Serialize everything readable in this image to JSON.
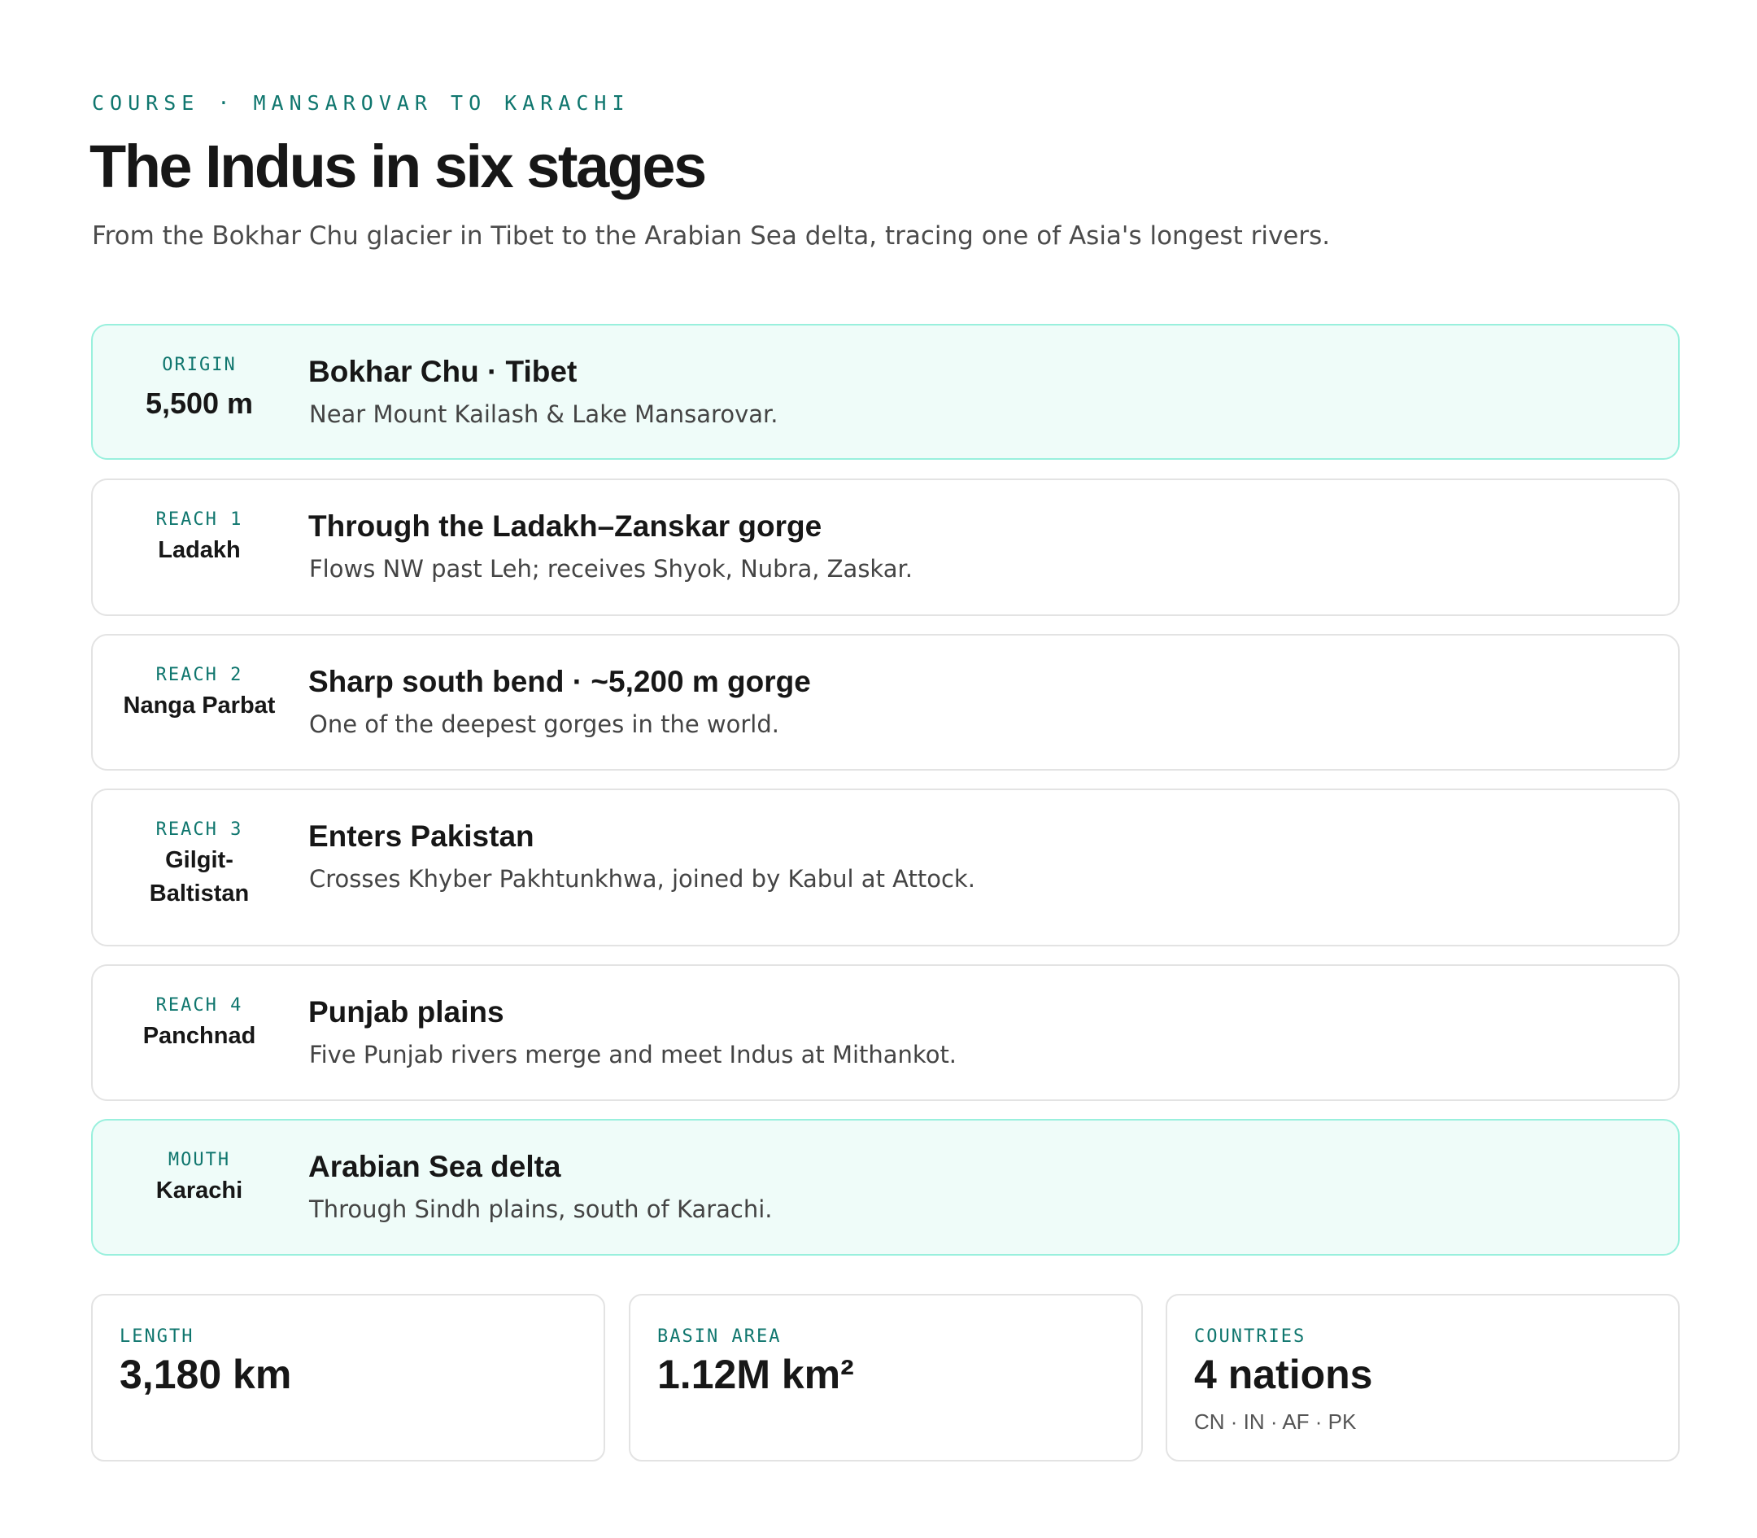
{
  "header": {
    "eyebrow": "COURSE · MANSAROVAR TO KARACHI",
    "title": "The Indus in six stages",
    "subtitle": "From the Bokhar Chu glacier in Tibet to the Arabian Sea delta, tracing one of Asia's longest rivers."
  },
  "stages": [
    {
      "tag": "ORIGIN",
      "place": "5,500 m",
      "heading": "Bokhar Chu · Tibet",
      "description": "Near Mount Kailash & Lake Mansarovar.",
      "highlighted": true
    },
    {
      "tag": "REACH 1",
      "place": "Ladakh",
      "heading": "Through the Ladakh–Zanskar gorge",
      "description": "Flows NW past Leh; receives Shyok, Nubra, Zaskar.",
      "highlighted": false
    },
    {
      "tag": "REACH 2",
      "place": "Nanga Parbat",
      "heading": "Sharp south bend · ~5,200 m gorge",
      "description": "One of the deepest gorges in the world.",
      "highlighted": false
    },
    {
      "tag": "REACH 3",
      "place_line_1": "Gilgit-",
      "place_line_2": "Baltistan",
      "heading": "Enters Pakistan",
      "description": "Crosses Khyber Pakhtunkhwa, joined by Kabul at Attock.",
      "highlighted": false
    },
    {
      "tag": "REACH 4",
      "place": "Panchnad",
      "heading": "Punjab plains",
      "description": "Five Punjab rivers merge and meet Indus at Mithankot.",
      "highlighted": false
    },
    {
      "tag": "MOUTH",
      "place": "Karachi",
      "heading": "Arabian Sea delta",
      "description": "Through Sindh plains, south of Karachi.",
      "highlighted": true
    }
  ],
  "stats": [
    {
      "label": "LENGTH",
      "value": "3,180 km"
    },
    {
      "label": "BASIN AREA",
      "value": "1.12M km²"
    },
    {
      "label": "COUNTRIES",
      "value": "4 nations",
      "note": "CN · IN · AF · PK"
    }
  ],
  "colors": {
    "accent": "#0f766e",
    "highlight_bg": "#effcf9",
    "highlight_border": "#99f0dd",
    "card_border": "#e3e3e3"
  }
}
